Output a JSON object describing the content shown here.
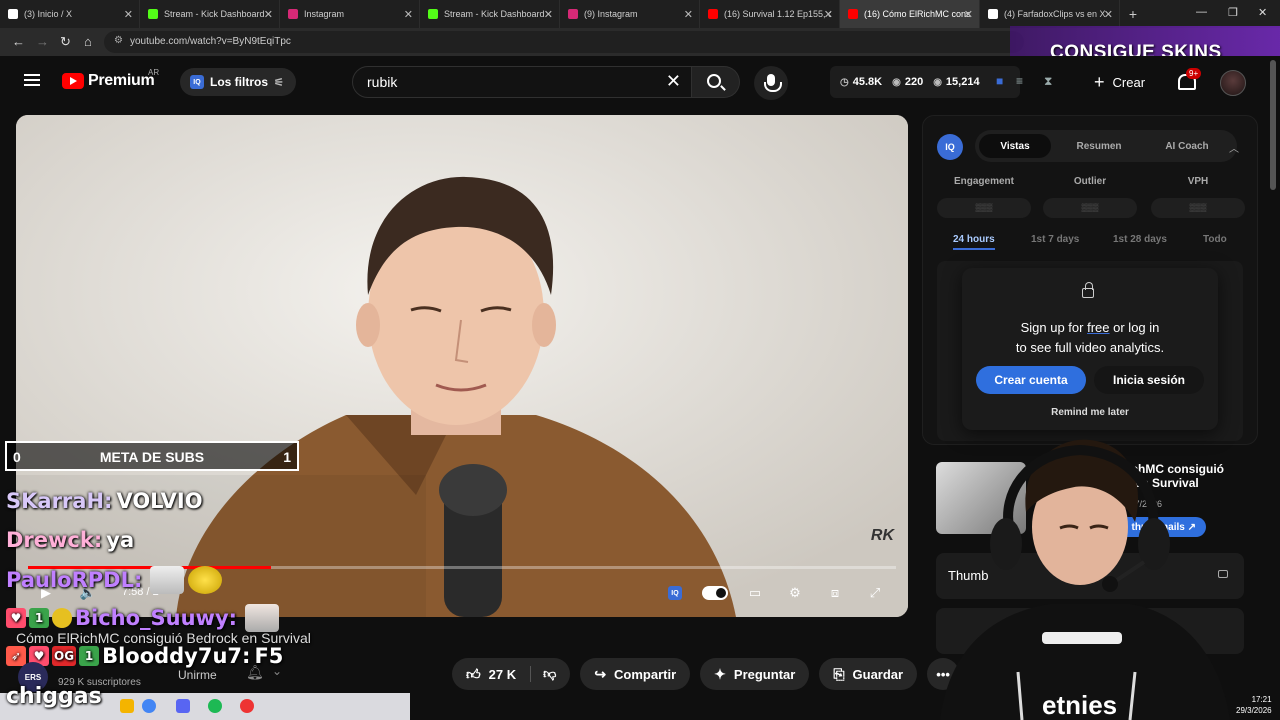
{
  "browser": {
    "tabs": [
      {
        "label": "(3) Inicio / X",
        "icon": "x-logo",
        "color": "#ffffff"
      },
      {
        "label": "Stream - Kick Dashboard",
        "icon": "kick-logo",
        "color": "#53fc18"
      },
      {
        "label": "Instagram",
        "icon": "instagram-logo",
        "color": "#d62976"
      },
      {
        "label": "Stream - Kick Dashboard",
        "icon": "kick-logo",
        "color": "#53fc18"
      },
      {
        "label": "(9) Instagram",
        "icon": "instagram-logo",
        "color": "#d62976"
      },
      {
        "label": "(16) Survival 1.12 Ep155, c",
        "icon": "youtube-logo",
        "color": "#ff0000"
      },
      {
        "label": "(16) Cómo ElRichMC cons",
        "icon": "youtube-logo",
        "color": "#ff0000"
      },
      {
        "label": "(4) FarfadoxClips vs en X",
        "icon": "x-logo",
        "color": "#ffffff"
      }
    ],
    "new_tab": "+",
    "url": "youtube.com/watch?v=ByN9tEqiTpc"
  },
  "header": {
    "logo_text": "Premium",
    "country": "AR",
    "filters_label": "Los filtros",
    "search_value": "rubik",
    "stats": {
      "views": "45.8K",
      "watching": "220",
      "other": "15,214"
    },
    "create_label": "Crear",
    "notifications": "9+"
  },
  "overlay": {
    "skins_text": "CONSIGUE SKINS",
    "meta": {
      "left": "0",
      "label": "META DE SUBS",
      "right": "1"
    },
    "chat": [
      {
        "user": "SKarraH:",
        "msg": "VOLVIO",
        "color": "#d8c8f8"
      },
      {
        "user": "Drewck:",
        "msg": "ya",
        "color": "#ffb0d8"
      },
      {
        "user": "PauloRPDL:",
        "msg": "",
        "color": "#c080ff"
      },
      {
        "user": "Bicho_Suuwy:",
        "msg": "",
        "color": "#c080ff"
      },
      {
        "user": "Blooddy7u7:",
        "msg": "F5",
        "color": "#ffffff"
      }
    ],
    "bottom_text": "chiggas"
  },
  "video": {
    "watermark": "RK",
    "time": "7:58 / 2",
    "progress": 0.28,
    "title": "Cómo ElRichMC consiguió Bedrock en Survival",
    "subscribers": "929 K suscriptores",
    "join_label": "Unirme",
    "channel_abbr": "ERS"
  },
  "actions": {
    "likes": "27 K",
    "share": "Compartir",
    "ask": "Preguntar",
    "save": "Guardar"
  },
  "panel": {
    "logo": "IQ",
    "tabs": [
      "Vistas",
      "Resumen",
      "AI Coach"
    ],
    "metrics": [
      "Engagement",
      "Outlier",
      "VPH"
    ],
    "periods": [
      "24 hours",
      "1st 7 days",
      "1st 28 days",
      "Todo"
    ],
    "modal": {
      "line1_pre": "Sign up for",
      "line1_free": "free",
      "line1_post": "or log in",
      "line2": "to see full video analytics.",
      "create": "Crear cuenta",
      "login": "Inicia sesión",
      "remind": "Remind me later"
    }
  },
  "related": {
    "title": "ElRichMC consiguió ...ck en Survival",
    "date": "3/27/2026",
    "button": "thumbnails ↗"
  },
  "thumbnails_row": "Thumb",
  "taskbar": {
    "time": "17:21",
    "date": "29/3/2026"
  }
}
